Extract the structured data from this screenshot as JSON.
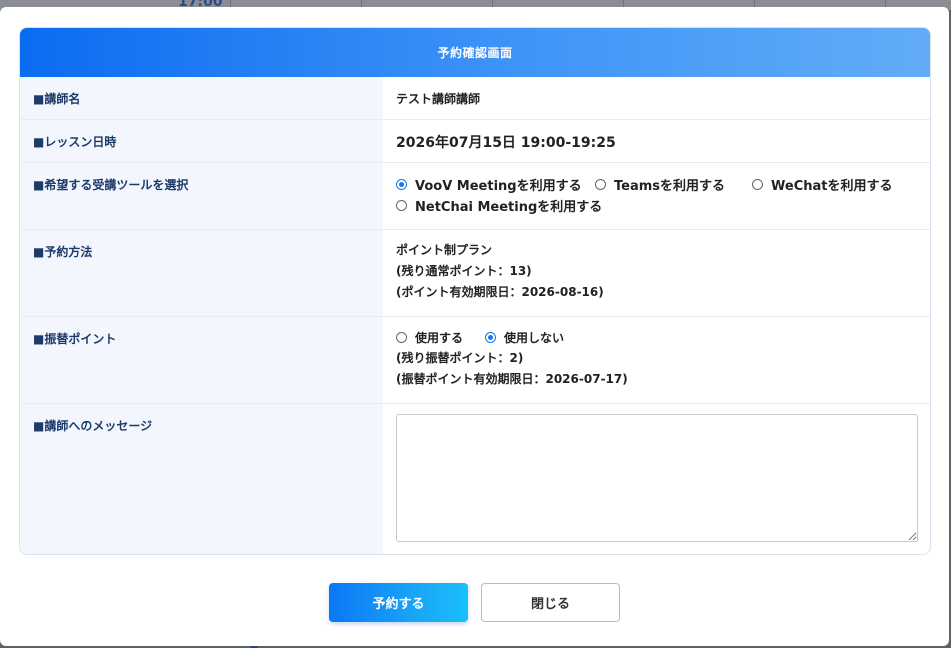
{
  "background": {
    "time_label": "17:00"
  },
  "modal": {
    "title": "予約確認画面",
    "rows": {
      "teacher": {
        "label": "■講師名",
        "value": "テスト講師講師"
      },
      "datetime": {
        "label": "■レッスン日時",
        "value": "2026年07月15日 19:00-19:25"
      },
      "tool": {
        "label": "■希望する受講ツールを選択",
        "options": [
          {
            "label": "VooV Meetingを利用する",
            "checked": true
          },
          {
            "label": "Teamsを利用する",
            "checked": false
          },
          {
            "label": "WeChatを利用する",
            "checked": false
          },
          {
            "label": "NetChai Meetingを利用する",
            "checked": false
          }
        ]
      },
      "method": {
        "label": "■予約方法",
        "plan": "ポイント制プラン",
        "remaining": "(残り通常ポイント：13)",
        "expiry": "(ポイント有効期限日：2026-08-16)"
      },
      "transfer": {
        "label": "■振替ポイント",
        "options": [
          {
            "label": "使用する",
            "checked": false
          },
          {
            "label": "使用しない",
            "checked": true
          }
        ],
        "remaining": "(残り振替ポイント：2)",
        "expiry": "(振替ポイント有効期限日：2026-07-17)"
      },
      "message": {
        "label": "■講師へのメッセージ",
        "value": "",
        "placeholder": ""
      }
    },
    "buttons": {
      "reserve": "予約する",
      "close": "閉じる"
    }
  },
  "colors": {
    "header_gradient_start": "#0a6cf0",
    "header_gradient_end": "#62acf8",
    "label_bg": "#f3f7fd",
    "label_text": "#1d3a6a",
    "radio_checked": "#1a73e8"
  }
}
